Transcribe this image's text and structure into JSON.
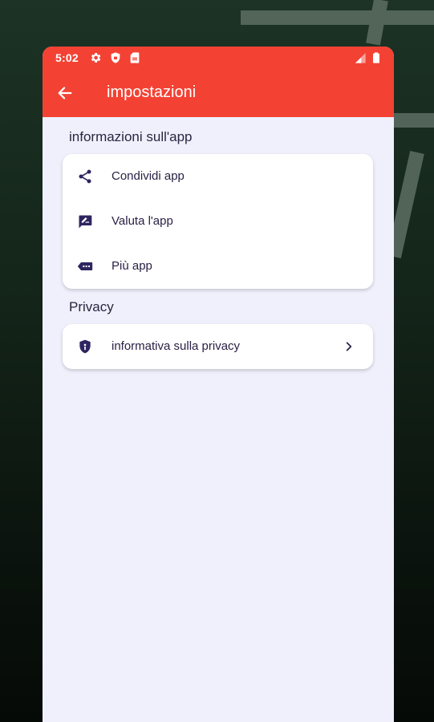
{
  "status_bar": {
    "time": "5:02",
    "icons": [
      "settings-icon",
      "shield-icon",
      "sim-card-icon",
      "signal-icon",
      "battery-icon"
    ]
  },
  "app_bar": {
    "back_icon": "arrow-left-icon",
    "title": "impostazioni"
  },
  "sections": {
    "app_info": {
      "title": "informazioni sull'app",
      "items": [
        {
          "label": "Condividi app",
          "icon": "share-icon"
        },
        {
          "label": "Valuta l'app",
          "icon": "rate-feedback-icon"
        },
        {
          "label": "Più app",
          "icon": "more-apps-icon"
        }
      ]
    },
    "privacy": {
      "title": "Privacy",
      "items": [
        {
          "label": "informativa sulla privacy",
          "icon": "shield-icon",
          "trailing_icon": "chevron-right-icon"
        }
      ]
    }
  },
  "colors": {
    "accent": "#f34234",
    "surface": "#f0f0fc",
    "card": "#ffffff",
    "icon": "#2e2560",
    "text": "#2a2145"
  }
}
